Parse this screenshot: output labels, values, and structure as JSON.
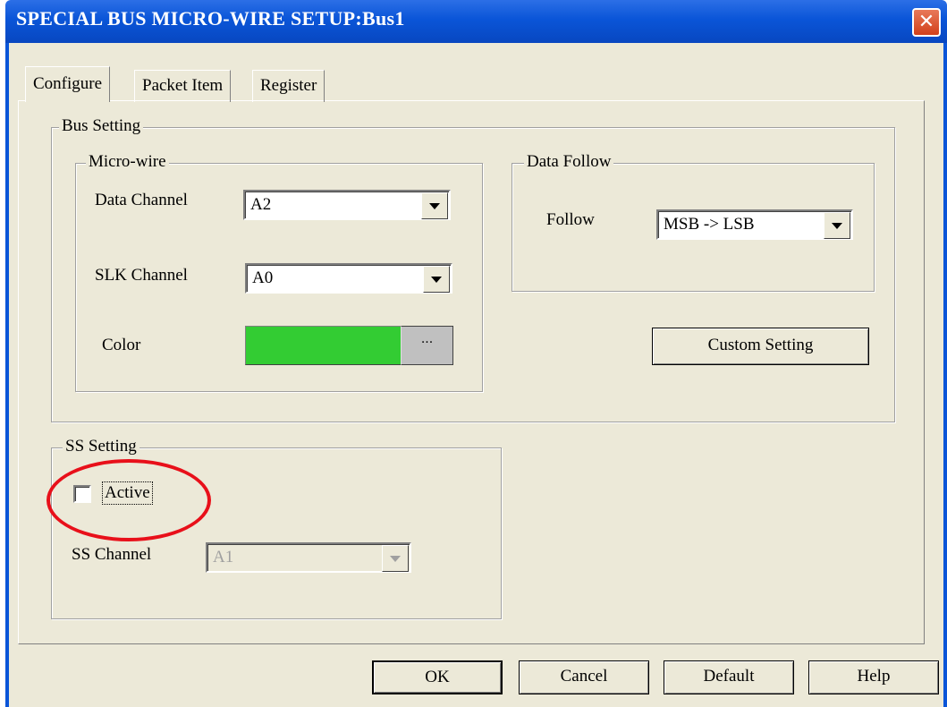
{
  "window": {
    "title": "SPECIAL BUS MICRO-WIRE SETUP:Bus1",
    "close_glyph": "✕"
  },
  "tabs": [
    {
      "label": "Configure",
      "active": true
    },
    {
      "label": "Packet Item",
      "active": false
    },
    {
      "label": "Register",
      "active": false
    }
  ],
  "bus_setting": {
    "legend": "Bus Setting",
    "micro_wire": {
      "legend": "Micro-wire",
      "data_channel": {
        "label": "Data Channel",
        "value": "A2"
      },
      "slk_channel": {
        "label": "SLK Channel",
        "value": "A0"
      },
      "color": {
        "label": "Color",
        "swatch": "#33cc33",
        "button_label": "···"
      }
    },
    "data_follow": {
      "legend": "Data Follow",
      "follow": {
        "label": "Follow",
        "value": "MSB -> LSB"
      }
    },
    "custom_setting_label": "Custom Setting"
  },
  "ss_setting": {
    "legend": "SS Setting",
    "active": {
      "label": "Active",
      "checked": false
    },
    "ss_channel": {
      "label": "SS Channel",
      "value": "A1",
      "enabled": false
    }
  },
  "buttons": {
    "ok": "OK",
    "cancel": "Cancel",
    "default": "Default",
    "help": "Help"
  },
  "annotation": {
    "circle_color": "#e8101a"
  }
}
